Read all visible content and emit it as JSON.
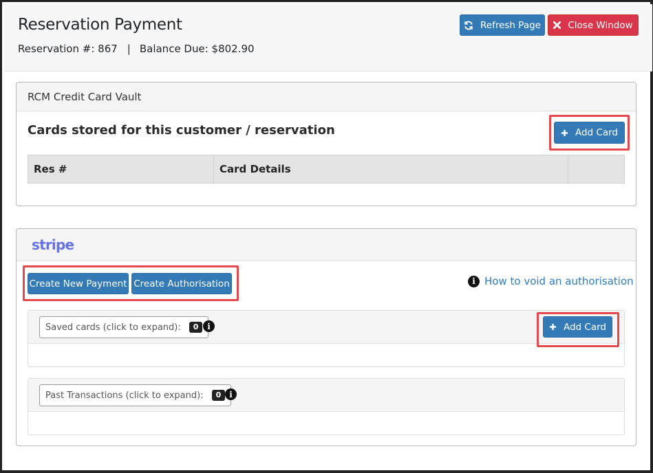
{
  "header": {
    "title": "Reservation Payment",
    "reservation_label": "Reservation #: 867",
    "separator": "|",
    "balance_label": "Balance Due: $802.90",
    "refresh_label": "Refresh Page",
    "close_label": "Close Window"
  },
  "vault": {
    "title": "RCM Credit Card Vault",
    "heading": "Cards stored for this customer / reservation",
    "add_card_label": "Add Card",
    "columns": [
      "Res #",
      "Card Details",
      ""
    ]
  },
  "stripe": {
    "logo": "stripe",
    "create_payment_label": "Create New Payment",
    "create_authorisation_label": "Create Authorisation",
    "void_link": "How to void an authorisation",
    "saved_cards_label": "Saved cards (click to expand):",
    "saved_cards_count": "0",
    "add_card_label": "Add Card",
    "past_transactions_label": "Past Transactions (click to expand):",
    "past_transactions_count": "0"
  },
  "icons": {
    "refresh": "refresh-icon",
    "close": "close-icon",
    "plus": "plus-icon",
    "info": "info-icon"
  },
  "colors": {
    "primary": "#337ab7",
    "danger": "#d9354b",
    "stripe": "#6772e5",
    "highlight": "#e5484d"
  }
}
